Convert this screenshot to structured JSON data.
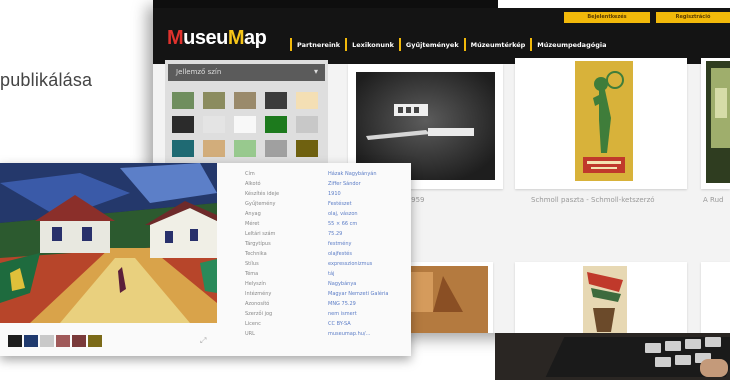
{
  "background_heading": "publikálása",
  "museumap": {
    "logo": {
      "m1": "M",
      "rest1": "useu",
      "m2": "M",
      "rest2": "ap"
    },
    "top_buttons": [
      "Bejelentkezés",
      "Regisztráció"
    ],
    "nav": [
      "Partnereink",
      "Lexikonunk",
      "Gyűjtemények",
      "Múzeumtérkép",
      "Múzeumpedagógia"
    ],
    "sidebar": {
      "select_label": "Jellemző szín",
      "swatches": [
        "#6f8e5e",
        "#8b8c5f",
        "#9a8a6b",
        "#3c3c3c",
        "#f4dfb4",
        "#2b2b2b",
        "#e4e4e4",
        "#f8f8f8",
        "#1d7a1d",
        "#c8c8c8",
        "#1f6a73",
        "#d2ad7b",
        "#98c98e",
        "#a0a0a0",
        "#6f6110"
      ]
    },
    "result_captions": [
      "ívek, 1956 - 1959",
      "Schmoll paszta - Schmoll-ketszerzó",
      "A Rud"
    ]
  },
  "detail": {
    "metadata": [
      {
        "k": "Cím",
        "v": "Házak Nagybányán"
      },
      {
        "k": "Alkotó",
        "v": "Ziffer Sándor"
      },
      {
        "k": "Készítés ideje",
        "v": "1910"
      },
      {
        "k": "Gyűjtemény",
        "v": "Festészet"
      },
      {
        "k": "Anyag",
        "v": "olaj, vászon"
      },
      {
        "k": "Méret",
        "v": "55 × 66 cm"
      },
      {
        "k": "Leltári szám",
        "v": "75.29"
      },
      {
        "k": "Tárgytípus",
        "v": "festmény"
      },
      {
        "k": "Technika",
        "v": "olajfestés"
      },
      {
        "k": "Stílus",
        "v": "expresszionizmus"
      },
      {
        "k": "Téma",
        "v": "táj"
      },
      {
        "k": "Helyszín",
        "v": "Nagybánya"
      },
      {
        "k": "Intézmény",
        "v": "Magyar Nemzeti Galéria"
      },
      {
        "k": "Azonosító",
        "v": "MNG 75.29"
      },
      {
        "k": "Szerzői jog",
        "v": "nem ismert"
      },
      {
        "k": "Licenc",
        "v": "CC BY-SA"
      },
      {
        "k": "URL",
        "v": "museumap.hu/..."
      }
    ],
    "palette": [
      "#1e1e1e",
      "#203a6e",
      "#c9c9c9",
      "#a05a5a",
      "#7a3a3a",
      "#7b6a18"
    ],
    "palette_small": [
      "#555",
      "#777",
      "#888",
      "#999",
      "#aaa"
    ],
    "palette_codes": [
      "#333333",
      "#777777",
      "#AAAAAA"
    ]
  }
}
